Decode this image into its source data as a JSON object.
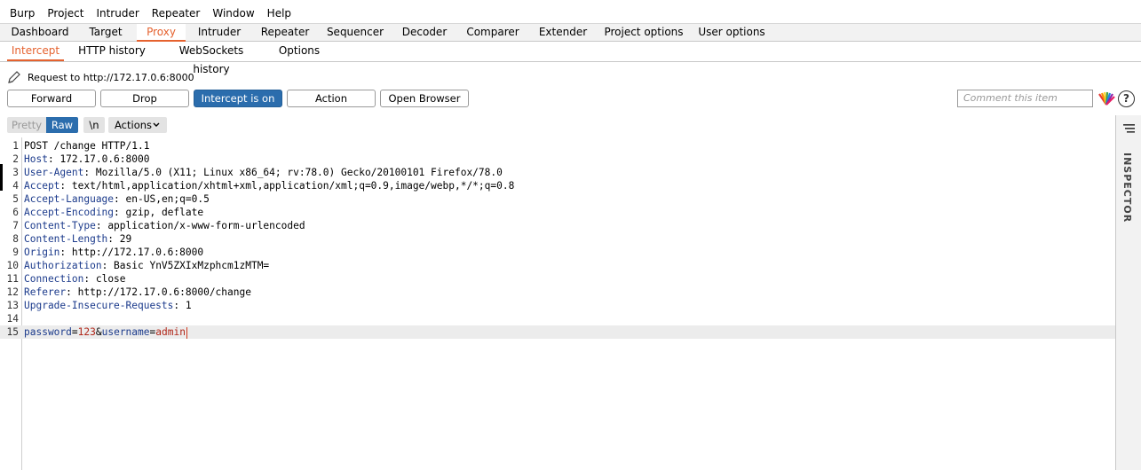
{
  "menu": [
    "Burp",
    "Project",
    "Intruder",
    "Repeater",
    "Window",
    "Help"
  ],
  "main_tabs": [
    "Dashboard",
    "Target",
    "Proxy",
    "Intruder",
    "Repeater",
    "Sequencer",
    "Decoder",
    "Comparer",
    "Extender",
    "Project options",
    "User options"
  ],
  "active_main_tab": "Proxy",
  "sub_tabs": [
    "Intercept",
    "HTTP history",
    "WebSockets history",
    "Options"
  ],
  "active_sub_tab": "Intercept",
  "request_line": "Request to http://172.17.0.6:8000",
  "buttons": {
    "forward": "Forward",
    "drop": "Drop",
    "intercept": "Intercept is on",
    "action": "Action",
    "open_browser": "Open Browser"
  },
  "comment_placeholder": "Comment this item",
  "help": "?",
  "editor_toolbar": {
    "pretty": "Pretty",
    "raw": "Raw",
    "newline": "\\n",
    "actions": "Actions"
  },
  "inspector_label": "INSPECTOR",
  "request": {
    "line1": "POST /change HTTP/1.1",
    "headers": [
      {
        "key": "Host",
        "value": "172.17.0.6:8000"
      },
      {
        "key": "User-Agent",
        "value": "Mozilla/5.0 (X11; Linux x86_64; rv:78.0) Gecko/20100101 Firefox/78.0"
      },
      {
        "key": "Accept",
        "value": "text/html,application/xhtml+xml,application/xml;q=0.9,image/webp,*/*;q=0.8"
      },
      {
        "key": "Accept-Language",
        "value": "en-US,en;q=0.5"
      },
      {
        "key": "Accept-Encoding",
        "value": "gzip, deflate"
      },
      {
        "key": "Content-Type",
        "value": "application/x-www-form-urlencoded"
      },
      {
        "key": "Content-Length",
        "value": "29"
      },
      {
        "key": "Origin",
        "value": "http://172.17.0.6:8000"
      },
      {
        "key": "Authorization",
        "value": "Basic YnV5ZXIxMzphcm1zMTM="
      },
      {
        "key": "Connection",
        "value": "close"
      },
      {
        "key": "Referer",
        "value": "http://172.17.0.6:8000/change"
      },
      {
        "key": "Upgrade-Insecure-Requests",
        "value": "1"
      }
    ],
    "body_params": [
      {
        "key": "password",
        "value": "123"
      },
      {
        "key": "username",
        "value": "admin"
      }
    ]
  },
  "colors": {
    "accent": "#e5622f",
    "primary_button": "#2b6dad",
    "header_key": "#1c3b8c",
    "param_value": "#b0271a"
  }
}
